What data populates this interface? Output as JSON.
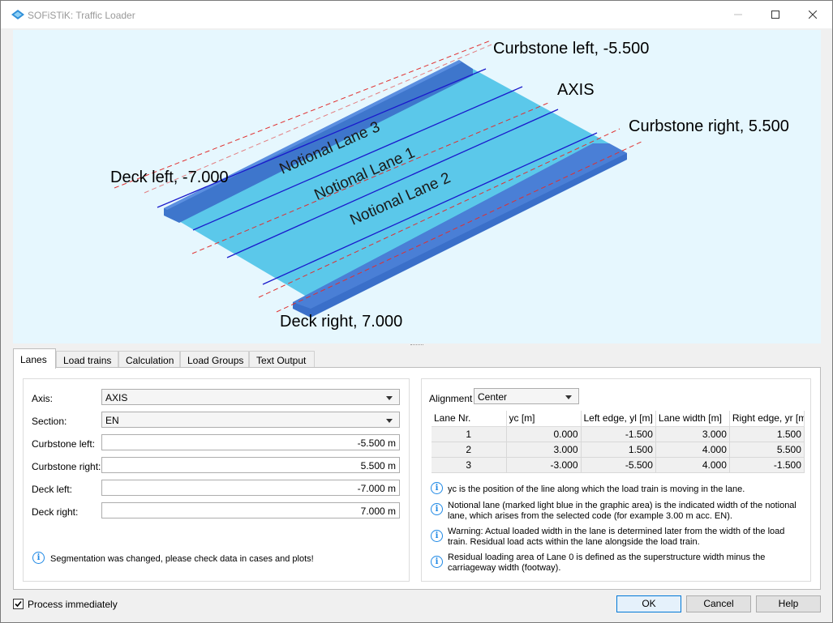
{
  "window": {
    "title": "SOFiSTiK: Traffic Loader"
  },
  "canvas": {
    "labels": {
      "curbstone_left": "Curbstone left, -5.500",
      "axis": "AXIS",
      "curbstone_right": "Curbstone right, 5.500",
      "deck_left": "Deck left, -7.000",
      "deck_right": "Deck right, 7.000",
      "lane3": "Notional Lane 3",
      "lane1": "Notional Lane 1",
      "lane2": "Notional Lane 2"
    },
    "colors": {
      "background": "#e6f7fe",
      "deck": "#5bc8ea",
      "curb": "#3a6fc9",
      "lane_line": "#1a1acc",
      "dash": "#e03030"
    }
  },
  "tabs": [
    {
      "label": "Lanes",
      "active": true
    },
    {
      "label": "Load trains",
      "active": false
    },
    {
      "label": "Calculation",
      "active": false
    },
    {
      "label": "Load Groups",
      "active": false
    },
    {
      "label": "Text Output",
      "active": false
    }
  ],
  "form": {
    "axis": {
      "label": "Axis:",
      "value": "AXIS"
    },
    "section": {
      "label": "Section:",
      "value": "EN"
    },
    "curbstone_left": {
      "label": "Curbstone left:",
      "value": "-5.500 m"
    },
    "curbstone_right": {
      "label": "Curbstone right:",
      "value": "5.500 m"
    },
    "deck_left": {
      "label": "Deck left:",
      "value": "-7.000 m"
    },
    "deck_right": {
      "label": "Deck right:",
      "value": "7.000 m"
    },
    "segmentation_note": "Segmentation was changed, please check data in cases and plots!"
  },
  "alignment": {
    "label": "Alignment",
    "value": "Center"
  },
  "lane_table": {
    "columns": [
      "Lane Nr.",
      "yc [m]",
      "Left edge, yl [m]",
      "Lane width [m]",
      "Right edge, yr [m"
    ],
    "rows": [
      [
        "1",
        "0.000",
        "-1.500",
        "3.000",
        "1.500"
      ],
      [
        "2",
        "3.000",
        "1.500",
        "4.000",
        "5.500"
      ],
      [
        "3",
        "-3.000",
        "-5.500",
        "4.000",
        "-1.500"
      ]
    ]
  },
  "info_notes": [
    {
      "line1": "yc is the position of the line along which the load train is moving in the lane.",
      "line2": ""
    },
    {
      "line1": "Notional lane (marked light blue in the graphic area) is the indicated width of the notional",
      "line2": "lane, which arises from the selected code (for example 3.00 m acc. EN)."
    },
    {
      "line1": "Warning: Actual loaded width in the lane is determined later from the width of the load",
      "line2": "train. Residual load acts within the lane alongside the load train."
    },
    {
      "line1": "Residual loading area of Lane 0 is defined as the superstructure width minus the",
      "line2": "carriageway width (footway)."
    }
  ],
  "footer": {
    "process_immediately": "Process immediately",
    "ok": "OK",
    "cancel": "Cancel",
    "help": "Help"
  }
}
